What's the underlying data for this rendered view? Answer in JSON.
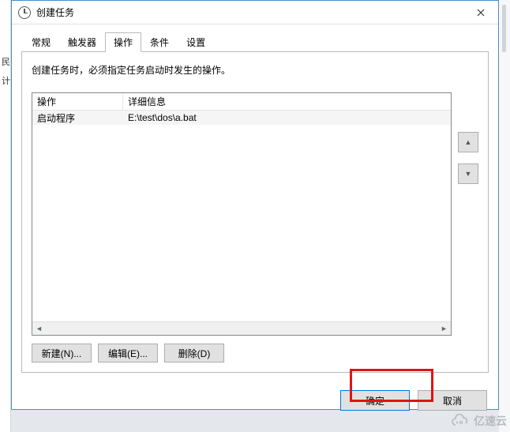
{
  "left_labels": [
    "民",
    "计"
  ],
  "window": {
    "title": "创建任务",
    "tabs": [
      {
        "label": "常规"
      },
      {
        "label": "触发器"
      },
      {
        "label": "操作"
      },
      {
        "label": "条件"
      },
      {
        "label": "设置"
      }
    ],
    "active_tab_index": 2,
    "description": "创建任务时，必须指定任务启动时发生的操作。",
    "list": {
      "columns": {
        "operation": "操作",
        "detail": "详细信息"
      },
      "rows": [
        {
          "operation": "启动程序",
          "detail": "E:\\test\\dos\\a.bat"
        }
      ]
    },
    "buttons": {
      "new": "新建(N)...",
      "edit": "编辑(E)...",
      "delete": "删除(D)"
    },
    "footer": {
      "ok": "确定",
      "cancel": "取消"
    }
  },
  "watermark": "亿速云"
}
